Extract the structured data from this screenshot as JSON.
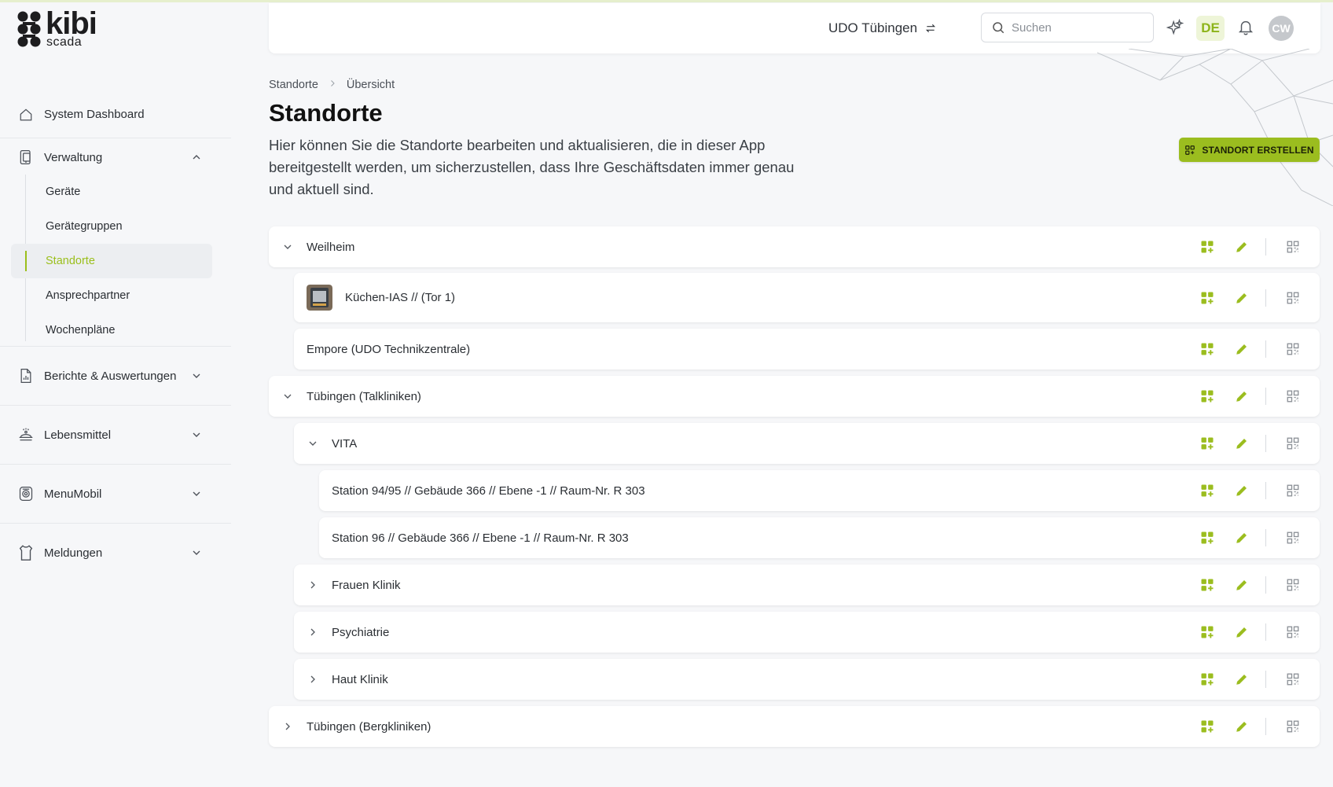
{
  "app": {
    "logo_main": "kibi",
    "logo_sub": "scada"
  },
  "sidebar": {
    "dashboard": {
      "label": "System Dashboard",
      "icon": "home-icon"
    },
    "groups": [
      {
        "label": "Verwaltung",
        "icon": "tablet-icon",
        "expanded": true,
        "items": [
          {
            "label": "Geräte",
            "active": false
          },
          {
            "label": "Gerätegruppen",
            "active": false
          },
          {
            "label": "Standorte",
            "active": true
          },
          {
            "label": "Ansprechpartner",
            "active": false
          },
          {
            "label": "Wochenpläne",
            "active": false
          }
        ]
      },
      {
        "label": "Berichte & Auswertungen",
        "icon": "report-icon",
        "expanded": false
      },
      {
        "label": "Lebensmittel",
        "icon": "food-icon",
        "expanded": false
      },
      {
        "label": "MenuMobil",
        "icon": "menumobil-icon",
        "expanded": false
      },
      {
        "label": "Meldungen",
        "icon": "apron-icon",
        "expanded": false
      }
    ]
  },
  "topbar": {
    "location": "UDO Tübingen",
    "search_placeholder": "Suchen",
    "language": "DE",
    "user_initials": "CW"
  },
  "breadcrumb": [
    "Standorte",
    "Übersicht"
  ],
  "page": {
    "title": "Standorte",
    "description": "Hier können Sie die Standorte bearbeiten und aktualisieren, die in dieser App bereitgestellt werden, um sicherzustellen, dass Ihre Geschäftsdaten immer genau und aktuell sind.",
    "create_button": "STANDORT ERSTELLEN"
  },
  "colors": {
    "accent": "#9bbd1f",
    "active_text": "#9bbf1c",
    "language_bg": "#eef5d8"
  },
  "tree": [
    {
      "label": "Weilheim",
      "level": 0,
      "toggle": "expanded"
    },
    {
      "label": "Küchen-IAS // (Tor 1)",
      "level": 1,
      "toggle": "none",
      "thumbnail": true
    },
    {
      "label": "Empore (UDO Technikzentrale)",
      "level": 1,
      "toggle": "none"
    },
    {
      "label": "Tübingen (Talkliniken)",
      "level": 0,
      "toggle": "expanded"
    },
    {
      "label": "VITA",
      "level": 1,
      "toggle": "expanded"
    },
    {
      "label": "Station 94/95 // Gebäude 366 // Ebene -1 // Raum-Nr. R 303",
      "level": 2,
      "toggle": "none"
    },
    {
      "label": "Station 96 // Gebäude 366 // Ebene -1 // Raum-Nr. R 303",
      "level": 2,
      "toggle": "none"
    },
    {
      "label": "Frauen Klinik",
      "level": 1,
      "toggle": "collapsed"
    },
    {
      "label": "Psychiatrie",
      "level": 1,
      "toggle": "collapsed"
    },
    {
      "label": "Haut Klinik",
      "level": 1,
      "toggle": "collapsed"
    },
    {
      "label": "Tübingen (Bergkliniken)",
      "level": 0,
      "toggle": "collapsed"
    }
  ]
}
